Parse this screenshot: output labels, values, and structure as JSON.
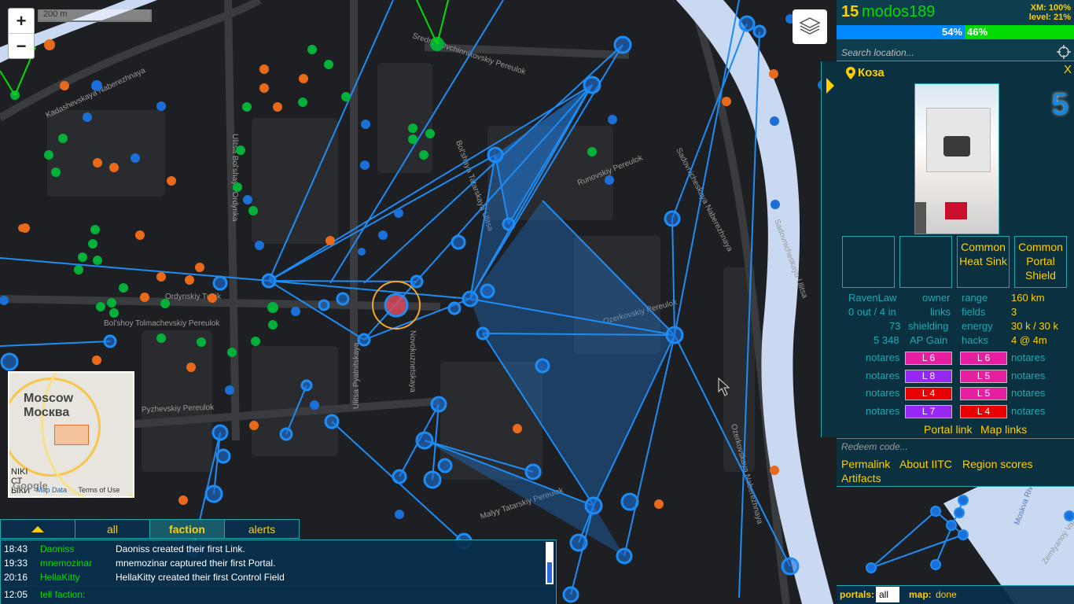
{
  "map": {
    "zoom_in": "+",
    "zoom_out": "−",
    "scale_label": "200 m",
    "street_labels": [
      "Kadashevskaya Naberezhnaya",
      "Sadovnicheskaya Naberezhnaya",
      "Ulitsa Bol'shaya Ordynka",
      "Ulitsa Pyatnitskaya",
      "Bol'shaya Tatarskaya Ulitsa",
      "Ozerkovskaya Naberezhnaya",
      "Runovskiy Pereulok",
      "Ordynskiy Tupik",
      "Pyzhevskiy Pereulok",
      "Novokuznetskaya",
      "Sadovnicheskaya Ulitsa",
      "Sredniy Ovchinnikovskiy Pereulok",
      "Ozerkovskiy Pereulok",
      "Bol'shoy Tolmachevskiy Pereulok",
      "Malyy Tatarskiy Pereulok",
      "Moskva River",
      "Zemlyanoy Val"
    ]
  },
  "minimap": {
    "city_en": "Moscow",
    "city_ru": "Москва",
    "map_data": "Map Data",
    "terms": "Terms of Use",
    "google": "Google"
  },
  "player": {
    "level": "15",
    "name": "modos189",
    "xm": "XM: 100%",
    "level_progress": "level: 21%",
    "res_percent": "54%",
    "enl_percent": "46%",
    "colors": {
      "enl": "#03dc03",
      "res": "#0088ff",
      "accent": "#ffce00"
    }
  },
  "search": {
    "placeholder": "Search location..."
  },
  "portal": {
    "title": "Коза",
    "level": "5",
    "close": "X",
    "mods": [
      "",
      "",
      "Common Heat Sink",
      "Common Portal Shield"
    ],
    "stats": [
      {
        "left_val": "RavenLaw",
        "left_key": "owner",
        "right_key": "range",
        "right_val": "160 km"
      },
      {
        "left_val": "0 out / 4 in",
        "left_key": "links",
        "right_key": "fields",
        "right_val": "3"
      },
      {
        "left_val": "73",
        "left_key": "shielding",
        "right_key": "energy",
        "right_val": "30 k / 30 k"
      },
      {
        "left_val": "5 348",
        "left_key": "AP Gain",
        "right_key": "hacks",
        "right_val": "4 @ 4m"
      }
    ],
    "resonators": [
      {
        "left_owner": "notares",
        "left_level": "L 6",
        "left_color": "#e61fa0",
        "right_level": "L 6",
        "right_color": "#e61fa0",
        "right_owner": "notares"
      },
      {
        "left_owner": "notares",
        "left_level": "L 8",
        "left_color": "#9627f4",
        "right_level": "L 5",
        "right_color": "#e61fa0",
        "right_owner": "notares"
      },
      {
        "left_owner": "notares",
        "left_level": "L 4",
        "left_color": "#e80000",
        "right_level": "L 5",
        "right_color": "#e61fa0",
        "right_owner": "notares"
      },
      {
        "left_owner": "notares",
        "left_level": "L 7",
        "left_color": "#9627f4",
        "right_level": "L 4",
        "right_color": "#e80000",
        "right_owner": "notares"
      }
    ],
    "portal_link": "Portal link",
    "map_links": "Map links"
  },
  "redeem": {
    "placeholder": "Redeem code..."
  },
  "toolbox": {
    "permalink": "Permalink",
    "about": "About IITC",
    "region": "Region scores",
    "artifacts": "Artifacts"
  },
  "status": {
    "portals_label": "portals:",
    "portals_value": "all",
    "map_label": "map:",
    "map_value": "done"
  },
  "chat": {
    "tabs": [
      "all",
      "faction",
      "alerts"
    ],
    "messages": [
      {
        "time": "18:43",
        "user": "Daoniss",
        "text": "Daoniss created their first Link."
      },
      {
        "time": "19:33",
        "user": "mnemozinar",
        "text": "mnemozinar captured their first Portal."
      },
      {
        "time": "20:16",
        "user": "HellaKitty",
        "text": "HellaKitty created their first Control Field"
      }
    ],
    "input_time": "12:05",
    "input_label": "tell faction:"
  }
}
